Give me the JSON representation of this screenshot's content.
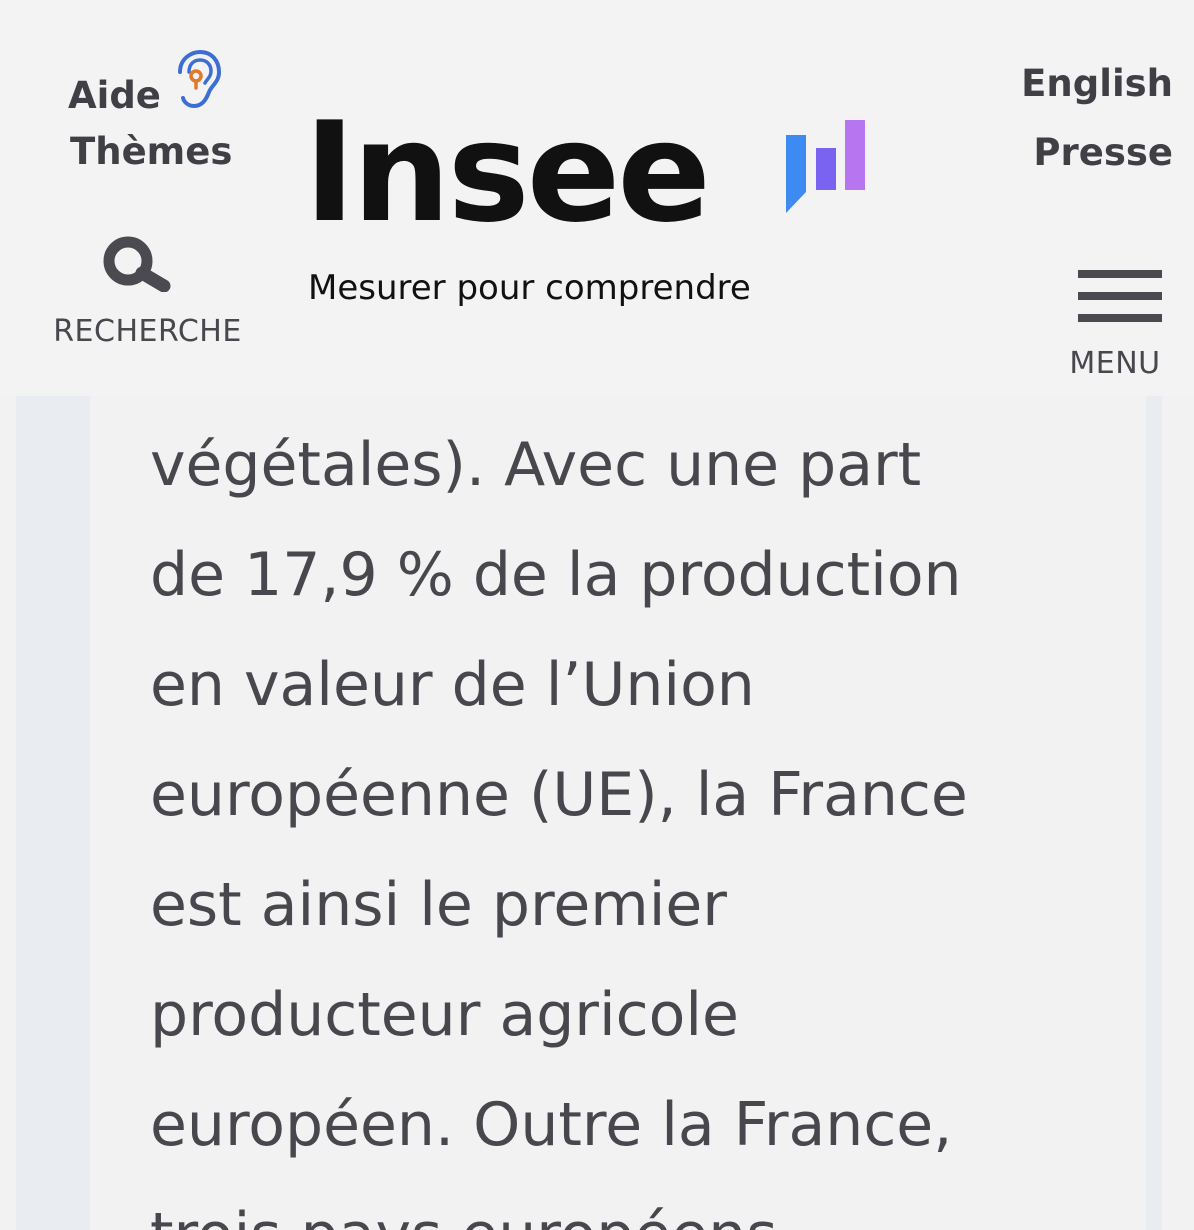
{
  "header": {
    "aide_label": "Aide",
    "themes_label": "Thèmes",
    "english_label": "English",
    "presse_label": "Presse",
    "search_label": "RECHERCHE",
    "menu_label": "MENU",
    "logo": {
      "wordmark": "Insee",
      "tagline": "Mesurer pour comprendre",
      "bar_colors": [
        "#3d8bf2",
        "#7a63f0",
        "#b775f0"
      ]
    },
    "icons": {
      "ear": "ear-icon",
      "search": "search-icon",
      "menu": "hamburger-menu-icon"
    }
  },
  "article": {
    "lines": [
      "végétales). Avec une part",
      "de 17,9 % de la production",
      "en valeur de l’Union",
      "européenne (UE), la France",
      "est ainsi le premier",
      "producteur agricole",
      "européen. Outre la France,",
      "trois pays européens"
    ]
  },
  "colors": {
    "text": "#47474d",
    "header_background": "#f3f3f3",
    "panel_border": "#e9ecf1"
  }
}
